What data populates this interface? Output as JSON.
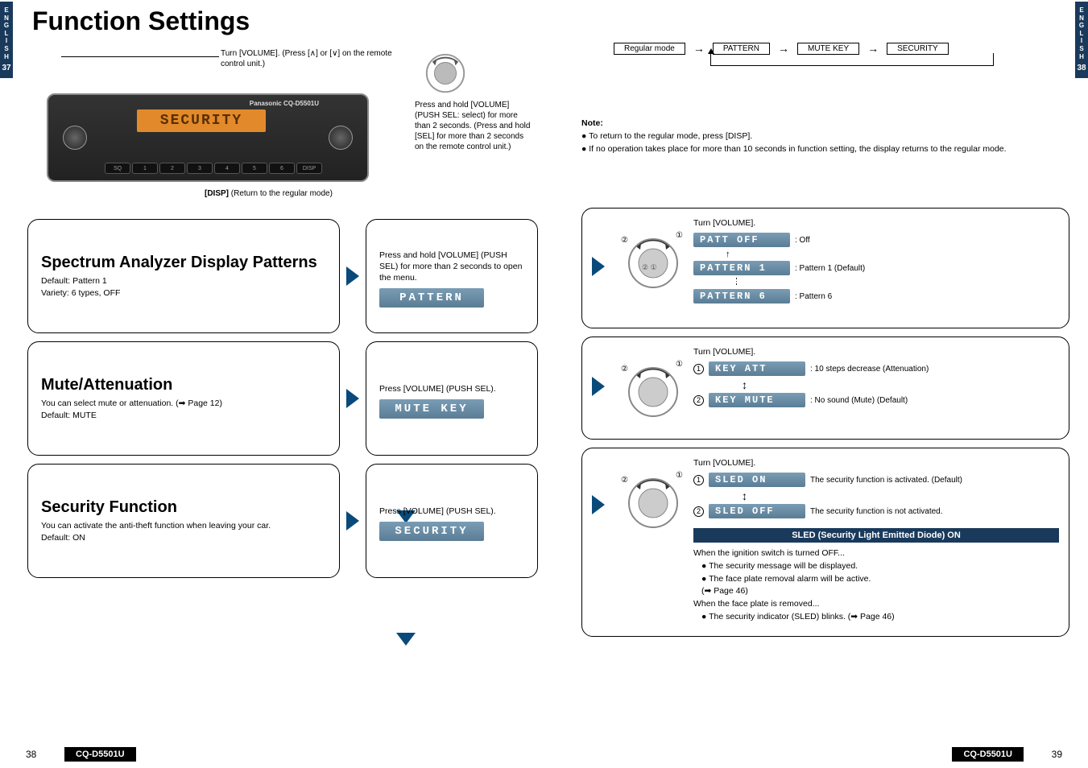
{
  "side_tab": {
    "lang": "E\nN\nG\nL\nI\nS\nH",
    "page_left": "37",
    "page_right": "38"
  },
  "title": "Function Settings",
  "top_instruction": "Turn [VOLUME]. (Press [∧] or [∨] on the remote control unit.)",
  "radio": {
    "brand_text": "Panasonic CQ-D5501U",
    "lcd": "SECURITY",
    "buttons": [
      "SQ",
      "1",
      "2",
      "3",
      "4",
      "5",
      "6",
      "DISP"
    ]
  },
  "disp_caption_bold": "[DISP]",
  "disp_caption_rest": " (Return to the regular mode)",
  "remote_text": "Press and hold [VOLUME] (PUSH SEL: select) for more than 2 seconds. (Press and hold [SEL] for more than 2 seconds on the remote control unit.)",
  "features": [
    {
      "title": "Spectrum Analyzer Display Patterns",
      "desc": "Default: Pattern 1\nVariety: 6 types, OFF",
      "right_instr": "Press and hold [VOLUME] (PUSH SEL) for more than 2 seconds to open the menu.",
      "lcd": "PATTERN"
    },
    {
      "title": "Mute/Attenuation",
      "desc": "You can select mute or attenuation. (➡ Page 12)\nDefault: MUTE",
      "right_instr": "Press [VOLUME] (PUSH SEL).",
      "lcd": "MUTE KEY"
    },
    {
      "title": "Security Function",
      "desc": "You can activate the anti-theft function when leaving your car.\nDefault: ON",
      "right_instr": "Press [VOLUME] (PUSH SEL).",
      "lcd": "SECURITY"
    }
  ],
  "flow": {
    "boxes": [
      "Regular mode",
      "PATTERN",
      "MUTE KEY",
      "SECURITY"
    ]
  },
  "note": {
    "title": "Note:",
    "lines": [
      "● To return to the regular mode, press [DISP].",
      "● If no operation takes place for more than 10 seconds in function setting, the display returns to the regular mode."
    ]
  },
  "settings": [
    {
      "turn": "Turn [VOLUME].",
      "options": [
        {
          "lcd": "PATT  OFF",
          "label": ": Off"
        },
        {
          "lcd": "PATTERN  1",
          "label": ": Pattern 1 (Default)"
        },
        {
          "lcd": "PATTERN  6",
          "label": ": Pattern 6"
        }
      ],
      "type": "patterns"
    },
    {
      "turn": "Turn [VOLUME].",
      "options": [
        {
          "num": "1",
          "lcd": "KEY  ATT",
          "label": ": 10 steps decrease (Attenuation)"
        },
        {
          "num": "2",
          "lcd": "KEY  MUTE",
          "label": ": No sound (Mute) (Default)"
        }
      ],
      "type": "mute"
    },
    {
      "turn": "Turn [VOLUME].",
      "options": [
        {
          "num": "1",
          "lcd": "SLED  ON",
          "label": "The security function is activated. (Default)"
        },
        {
          "num": "2",
          "lcd": "SLED  OFF",
          "label": "The security function is not activated."
        }
      ],
      "type": "security",
      "sled": {
        "bar": "SLED (Security Light Emitted Diode) ON",
        "lines": [
          "When the ignition switch is turned OFF...",
          "● The security message will be displayed.",
          "● The face plate removal alarm will be active.",
          "   (➡ Page 46)",
          "When the face plate is removed...",
          "● The security indicator (SLED) blinks. (➡ Page 46)"
        ]
      }
    }
  ],
  "footer": {
    "model": "CQ-D5501U",
    "page_left": "38",
    "page_right": "39"
  }
}
